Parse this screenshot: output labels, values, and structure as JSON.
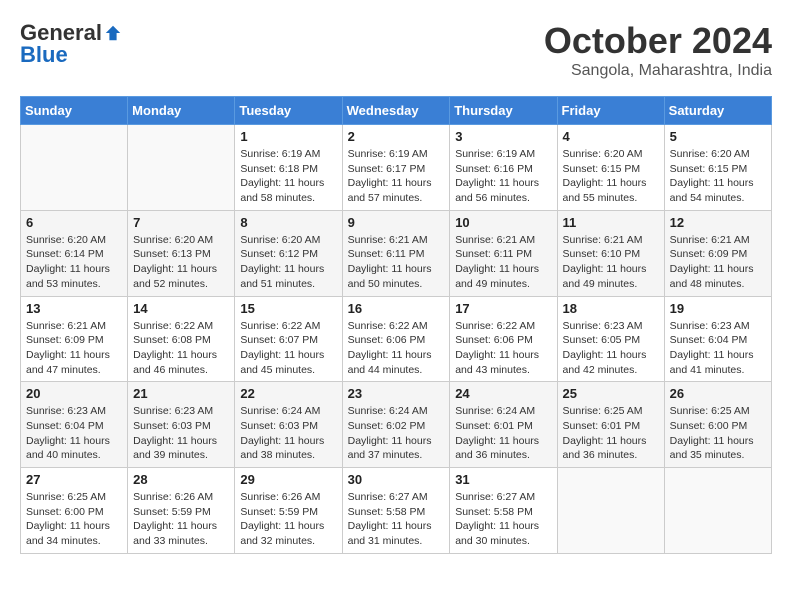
{
  "logo": {
    "general": "General",
    "blue": "Blue"
  },
  "title": "October 2024",
  "location": "Sangola, Maharashtra, India",
  "days_of_week": [
    "Sunday",
    "Monday",
    "Tuesday",
    "Wednesday",
    "Thursday",
    "Friday",
    "Saturday"
  ],
  "weeks": [
    [
      {
        "day": "",
        "text": ""
      },
      {
        "day": "",
        "text": ""
      },
      {
        "day": "1",
        "text": "Sunrise: 6:19 AM\nSunset: 6:18 PM\nDaylight: 11 hours and 58 minutes."
      },
      {
        "day": "2",
        "text": "Sunrise: 6:19 AM\nSunset: 6:17 PM\nDaylight: 11 hours and 57 minutes."
      },
      {
        "day": "3",
        "text": "Sunrise: 6:19 AM\nSunset: 6:16 PM\nDaylight: 11 hours and 56 minutes."
      },
      {
        "day": "4",
        "text": "Sunrise: 6:20 AM\nSunset: 6:15 PM\nDaylight: 11 hours and 55 minutes."
      },
      {
        "day": "5",
        "text": "Sunrise: 6:20 AM\nSunset: 6:15 PM\nDaylight: 11 hours and 54 minutes."
      }
    ],
    [
      {
        "day": "6",
        "text": "Sunrise: 6:20 AM\nSunset: 6:14 PM\nDaylight: 11 hours and 53 minutes."
      },
      {
        "day": "7",
        "text": "Sunrise: 6:20 AM\nSunset: 6:13 PM\nDaylight: 11 hours and 52 minutes."
      },
      {
        "day": "8",
        "text": "Sunrise: 6:20 AM\nSunset: 6:12 PM\nDaylight: 11 hours and 51 minutes."
      },
      {
        "day": "9",
        "text": "Sunrise: 6:21 AM\nSunset: 6:11 PM\nDaylight: 11 hours and 50 minutes."
      },
      {
        "day": "10",
        "text": "Sunrise: 6:21 AM\nSunset: 6:11 PM\nDaylight: 11 hours and 49 minutes."
      },
      {
        "day": "11",
        "text": "Sunrise: 6:21 AM\nSunset: 6:10 PM\nDaylight: 11 hours and 49 minutes."
      },
      {
        "day": "12",
        "text": "Sunrise: 6:21 AM\nSunset: 6:09 PM\nDaylight: 11 hours and 48 minutes."
      }
    ],
    [
      {
        "day": "13",
        "text": "Sunrise: 6:21 AM\nSunset: 6:09 PM\nDaylight: 11 hours and 47 minutes."
      },
      {
        "day": "14",
        "text": "Sunrise: 6:22 AM\nSunset: 6:08 PM\nDaylight: 11 hours and 46 minutes."
      },
      {
        "day": "15",
        "text": "Sunrise: 6:22 AM\nSunset: 6:07 PM\nDaylight: 11 hours and 45 minutes."
      },
      {
        "day": "16",
        "text": "Sunrise: 6:22 AM\nSunset: 6:06 PM\nDaylight: 11 hours and 44 minutes."
      },
      {
        "day": "17",
        "text": "Sunrise: 6:22 AM\nSunset: 6:06 PM\nDaylight: 11 hours and 43 minutes."
      },
      {
        "day": "18",
        "text": "Sunrise: 6:23 AM\nSunset: 6:05 PM\nDaylight: 11 hours and 42 minutes."
      },
      {
        "day": "19",
        "text": "Sunrise: 6:23 AM\nSunset: 6:04 PM\nDaylight: 11 hours and 41 minutes."
      }
    ],
    [
      {
        "day": "20",
        "text": "Sunrise: 6:23 AM\nSunset: 6:04 PM\nDaylight: 11 hours and 40 minutes."
      },
      {
        "day": "21",
        "text": "Sunrise: 6:23 AM\nSunset: 6:03 PM\nDaylight: 11 hours and 39 minutes."
      },
      {
        "day": "22",
        "text": "Sunrise: 6:24 AM\nSunset: 6:03 PM\nDaylight: 11 hours and 38 minutes."
      },
      {
        "day": "23",
        "text": "Sunrise: 6:24 AM\nSunset: 6:02 PM\nDaylight: 11 hours and 37 minutes."
      },
      {
        "day": "24",
        "text": "Sunrise: 6:24 AM\nSunset: 6:01 PM\nDaylight: 11 hours and 36 minutes."
      },
      {
        "day": "25",
        "text": "Sunrise: 6:25 AM\nSunset: 6:01 PM\nDaylight: 11 hours and 36 minutes."
      },
      {
        "day": "26",
        "text": "Sunrise: 6:25 AM\nSunset: 6:00 PM\nDaylight: 11 hours and 35 minutes."
      }
    ],
    [
      {
        "day": "27",
        "text": "Sunrise: 6:25 AM\nSunset: 6:00 PM\nDaylight: 11 hours and 34 minutes."
      },
      {
        "day": "28",
        "text": "Sunrise: 6:26 AM\nSunset: 5:59 PM\nDaylight: 11 hours and 33 minutes."
      },
      {
        "day": "29",
        "text": "Sunrise: 6:26 AM\nSunset: 5:59 PM\nDaylight: 11 hours and 32 minutes."
      },
      {
        "day": "30",
        "text": "Sunrise: 6:27 AM\nSunset: 5:58 PM\nDaylight: 11 hours and 31 minutes."
      },
      {
        "day": "31",
        "text": "Sunrise: 6:27 AM\nSunset: 5:58 PM\nDaylight: 11 hours and 30 minutes."
      },
      {
        "day": "",
        "text": ""
      },
      {
        "day": "",
        "text": ""
      }
    ]
  ]
}
